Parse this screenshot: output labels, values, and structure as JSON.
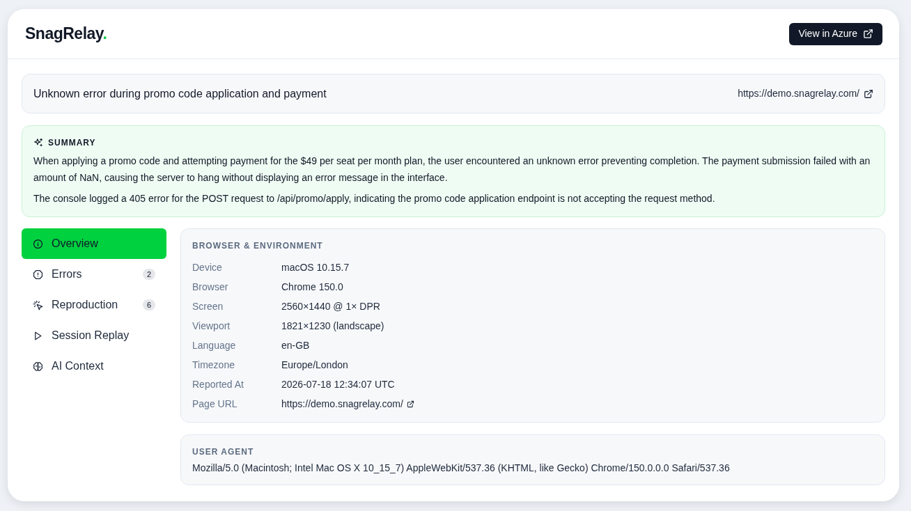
{
  "header": {
    "logo": {
      "text": "SnagRelay",
      "accent": "."
    },
    "action": {
      "label": "View in Azure"
    }
  },
  "issue": {
    "title": "Unknown error during promo code application and payment",
    "url": "https://demo.snagrelay.com/"
  },
  "summary": {
    "heading": "SUMMARY",
    "paragraphs": [
      "When applying a promo code and attempting payment for the $49 per seat per month plan, the user encountered an unknown error preventing completion. The payment submission failed with an amount of NaN, causing the server to hang without displaying an error message in the interface.",
      "The console logged a 405 error for the POST request to /api/promo/apply, indicating the promo code application endpoint is not accepting the request method."
    ]
  },
  "sidebar": {
    "items": [
      {
        "label": "Overview",
        "selected": true
      },
      {
        "label": "Errors",
        "count": "2",
        "selected": false
      },
      {
        "label": "Reproduction",
        "count": "6",
        "selected": false
      },
      {
        "label": "Session Replay",
        "selected": false
      },
      {
        "label": "AI Context",
        "selected": false
      }
    ]
  },
  "environment": {
    "heading": "BROWSER & ENVIRONMENT",
    "rows": [
      {
        "label": "Device",
        "value": "macOS 10.15.7",
        "kind": "text"
      },
      {
        "label": "Browser",
        "value": "Chrome 150.0",
        "kind": "text"
      },
      {
        "label": "Screen",
        "value": "2560×1440 @ 1× DPR",
        "kind": "text"
      },
      {
        "label": "Viewport",
        "value": "1821×1230 (landscape)",
        "kind": "text"
      },
      {
        "label": "Language",
        "value": "en-GB",
        "kind": "text"
      },
      {
        "label": "Timezone",
        "value": "Europe/London",
        "kind": "text"
      },
      {
        "label": "Reported At",
        "value": "2026-07-18 12:34:07 UTC",
        "kind": "text"
      },
      {
        "label": "Page URL",
        "value": "https://demo.snagrelay.com/",
        "kind": "link"
      }
    ]
  },
  "user_agent": {
    "heading": "USER AGENT",
    "value": "Mozilla/5.0 (Macintosh; Intel Mac OS X 10_15_7) AppleWebKit/537.36 (KHTML, like Gecko) Chrome/150.0.0.0 Safari/537.36"
  }
}
